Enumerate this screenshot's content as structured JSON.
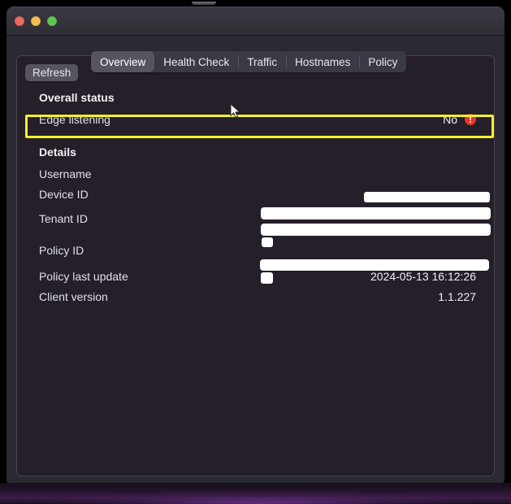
{
  "window": {
    "traffic_lights": [
      {
        "name": "close",
        "color": "#ec6a5e"
      },
      {
        "name": "minimize",
        "color": "#f4bd4f"
      },
      {
        "name": "maximize",
        "color": "#61c454"
      }
    ]
  },
  "tabs": [
    {
      "label": "Overview",
      "selected": true
    },
    {
      "label": "Health Check",
      "selected": false
    },
    {
      "label": "Traffic",
      "selected": false
    },
    {
      "label": "Hostnames",
      "selected": false
    },
    {
      "label": "Policy",
      "selected": false
    }
  ],
  "toolbar": {
    "refresh_label": "Refresh"
  },
  "overall_status": {
    "title": "Overall status",
    "rows": [
      {
        "label": "Edge listening",
        "value": "No",
        "status_icon": "error-exclamation-icon",
        "status_color": "#e8352d",
        "highlighted": true,
        "highlight_color": "#f5f02a"
      }
    ]
  },
  "details": {
    "title": "Details",
    "rows": [
      {
        "label": "Username",
        "value": "",
        "redacted": true
      },
      {
        "label": "Device ID",
        "value": "",
        "redacted": true
      },
      {
        "label": "Tenant ID",
        "value": "",
        "redacted": true
      },
      {
        "label": "Policy ID",
        "value": "",
        "redacted": true
      },
      {
        "label": "Policy last update",
        "value": "2024-05-13 16:12:26",
        "redacted": false
      },
      {
        "label": "Client version",
        "value": "1.1.227",
        "redacted": false
      }
    ]
  },
  "colors": {
    "window_chrome": "#343239",
    "window_body": "#2b2931",
    "content_panel": "#241f29",
    "tab_selected": "#56545f",
    "highlight_yellow": "#f5f02a",
    "error_red": "#e8352d"
  }
}
